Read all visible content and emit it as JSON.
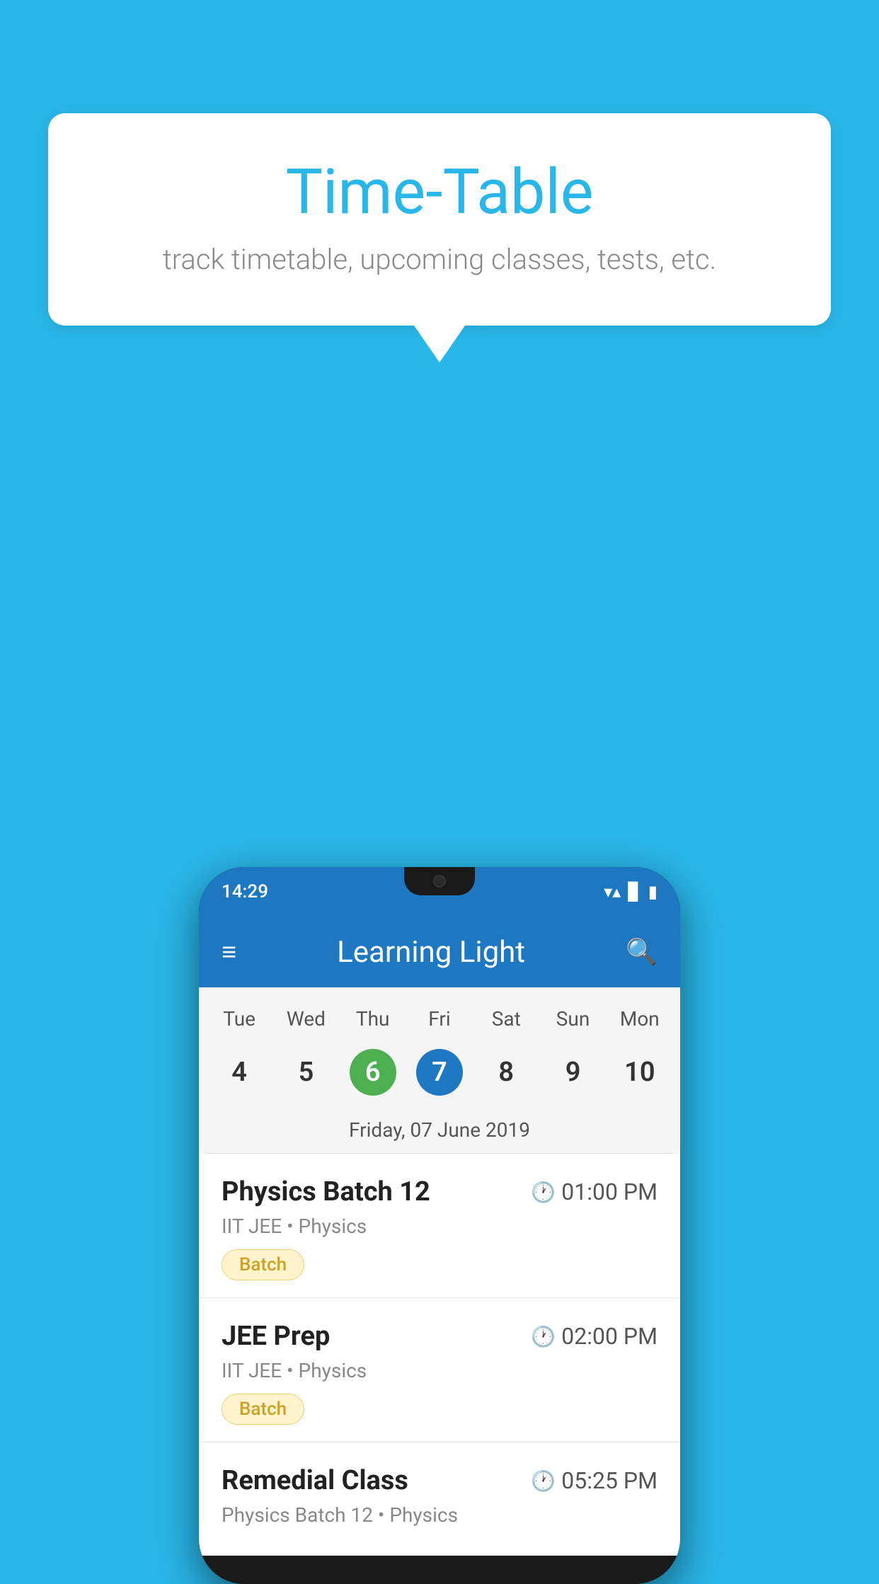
{
  "background_color": "#29b6e8",
  "speech_bubble": {
    "title": "Time-Table",
    "subtitle": "track timetable, upcoming classes, tests, etc."
  },
  "phone": {
    "status_bar": {
      "time": "14:29",
      "icons": [
        "wifi",
        "signal",
        "battery"
      ]
    },
    "app_bar": {
      "title": "Learning Light"
    },
    "calendar": {
      "days": [
        "Tue",
        "Wed",
        "Thu",
        "Fri",
        "Sat",
        "Sun",
        "Mon"
      ],
      "dates": [
        "4",
        "5",
        "6",
        "7",
        "8",
        "9",
        "10"
      ],
      "today_index": 2,
      "selected_index": 3,
      "selected_label": "Friday, 07 June 2019"
    },
    "schedule": [
      {
        "title": "Physics Batch 12",
        "time": "01:00 PM",
        "subtitle": "IIT JEE • Physics",
        "badge": "Batch"
      },
      {
        "title": "JEE Prep",
        "time": "02:00 PM",
        "subtitle": "IIT JEE • Physics",
        "badge": "Batch"
      },
      {
        "title": "Remedial Class",
        "time": "05:25 PM",
        "subtitle": "Physics Batch 12 • Physics",
        "badge": ""
      }
    ]
  },
  "icons": {
    "menu": "≡",
    "search": "🔍",
    "clock": "🕐"
  }
}
